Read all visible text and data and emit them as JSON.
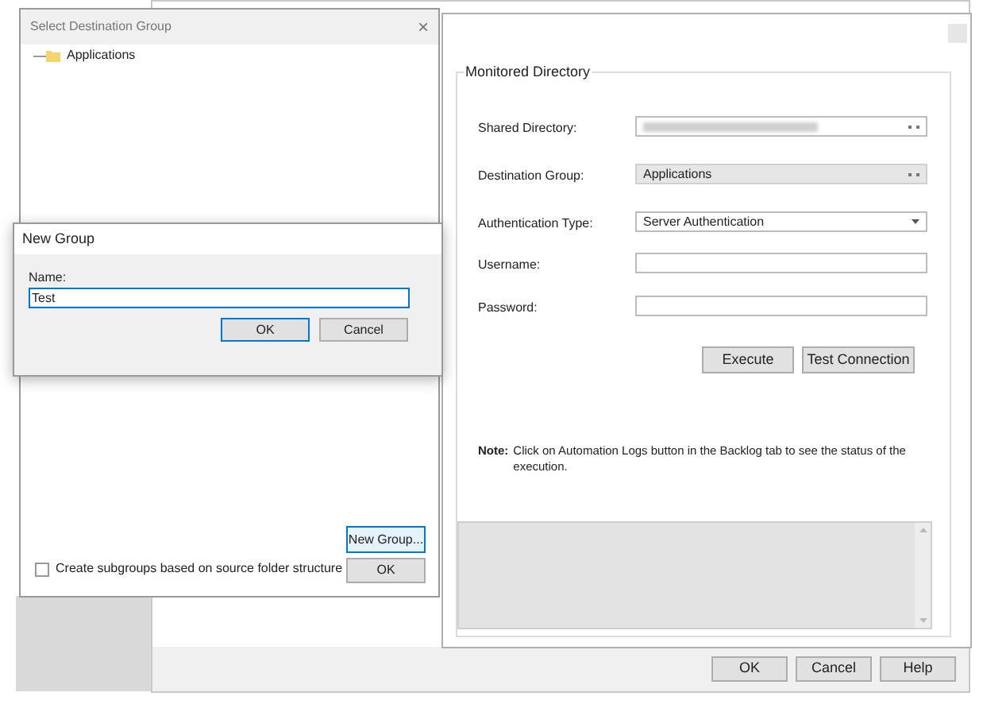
{
  "main_window": {
    "buttons": [
      "OK",
      "Cancel",
      "Help"
    ]
  },
  "monitored_directory": {
    "title": "Monitored Directory",
    "fields": [
      {
        "kind": "browse",
        "label": "Shared Directory:",
        "redacted": true,
        "disabled": false
      },
      {
        "kind": "browse",
        "label": "Destination Group:",
        "value": "Applications",
        "disabled": true
      },
      {
        "kind": "dropdown",
        "label": "Authentication Type:",
        "value": "Server Authentication",
        "disabled": false
      },
      {
        "kind": "text",
        "label": "Username:",
        "disabled": false
      },
      {
        "kind": "text",
        "label": "Password:",
        "disabled": false
      }
    ],
    "buttons": [
      "Execute",
      "Test Connection"
    ],
    "note_label": "Note:",
    "note": "Click on Automation Logs button in the Backlog tab to see the status of the execution."
  },
  "select_destination_group": {
    "title": "Select Destination Group",
    "close": "×",
    "tree": [
      {
        "label": "Applications",
        "selected": false
      }
    ],
    "new_group_button": "New Group...",
    "checkbox": {
      "label": "Create subgroups based on source folder structure",
      "checked": false
    },
    "ok_button": "OK"
  },
  "new_group_dialog": {
    "title": "New Group",
    "name_label": "Name:",
    "name_value": "Test",
    "buttons": [
      {
        "label": "OK",
        "default": true
      },
      {
        "label": "Cancel",
        "default": false
      }
    ]
  }
}
